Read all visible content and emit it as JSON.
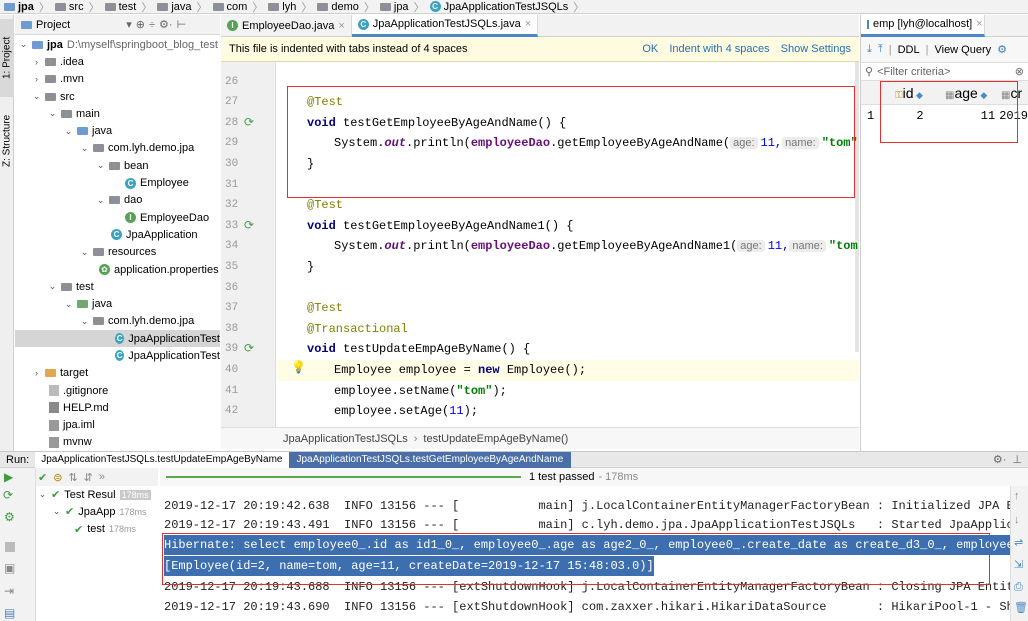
{
  "breadcrumb": [
    "jpa",
    "src",
    "test",
    "java",
    "com",
    "lyh",
    "demo",
    "jpa",
    "JpaApplicationTestJSQLs"
  ],
  "side_tabs": {
    "project": "1: Project",
    "structure": "Z: Structure"
  },
  "project_panel": {
    "title": "Project",
    "tree": [
      {
        "label": "jpa",
        "extra": "D:\\myself\\springboot_blog_test",
        "bold": true
      },
      {
        "label": ".idea"
      },
      {
        "label": ".mvn"
      },
      {
        "label": "src"
      },
      {
        "label": "main"
      },
      {
        "label": "java"
      },
      {
        "label": "com.lyh.demo.jpa"
      },
      {
        "label": "bean"
      },
      {
        "label": "Employee"
      },
      {
        "label": "dao"
      },
      {
        "label": "EmployeeDao"
      },
      {
        "label": "JpaApplication"
      },
      {
        "label": "resources"
      },
      {
        "label": "application.properties"
      },
      {
        "label": "test"
      },
      {
        "label": "java"
      },
      {
        "label": "com.lyh.demo.jpa"
      },
      {
        "label": "JpaApplicationTest"
      },
      {
        "label": "JpaApplicationTest"
      },
      {
        "label": "target"
      },
      {
        "label": ".gitignore"
      },
      {
        "label": "HELP.md"
      },
      {
        "label": "jpa.iml"
      },
      {
        "label": "mvnw"
      }
    ]
  },
  "editor": {
    "tabs": [
      {
        "label": "EmployeeDao.java",
        "active": false
      },
      {
        "label": "JpaApplicationTestJSQLs.java",
        "active": true
      }
    ],
    "notice": "This file is indented with tabs instead of 4 spaces",
    "notice_actions": [
      "OK",
      "Indent with 4 spaces",
      "Show Settings"
    ],
    "line_numbers": [
      "26",
      "27",
      "28",
      "29",
      "30",
      "31",
      "32",
      "33",
      "34",
      "35",
      "36",
      "37",
      "38",
      "39",
      "40",
      "41",
      "42"
    ],
    "code": {
      "l27": "@Test",
      "l28_kw": "void",
      "l28": " testGetEmployeeByAgeAndName() {",
      "l29_pre": "System.",
      "l29_out": "out",
      "l29_mid": ".println(",
      "l29_dao": "employeeDao",
      "l29_call": ".getEmployeeByAgeAndName(",
      "l29_h1": "age:",
      "l29_v1": "11,",
      "l29_h2": "name:",
      "l29_v2": "\"tom\"",
      "l30": "}",
      "l32": "@Test",
      "l33_kw": "void",
      "l33": " testGetEmployeeByAgeAndName1() {",
      "l34_call": ".getEmployeeByAgeAndName1(",
      "l35": "}",
      "l37": "@Test",
      "l38": "@Transactional",
      "l39_kw": "void",
      "l39": " testUpdateEmpAgeByName() {",
      "l40_a": "Employee employee = ",
      "l40_new": "new",
      "l40_b": " Employee();",
      "l41_a": "employee.setName(",
      "l41_s": "\"tom\"",
      "l41_b": ");",
      "l42_a": "employee.setAge(",
      "l42_n": "11",
      "l42_b": ");"
    },
    "crumb": [
      "JpaApplicationTestJSQLs",
      "testUpdateEmpAgeByName()"
    ]
  },
  "db_panel": {
    "tab": "emp [lyh@localhost]",
    "toolbar": [
      "DDL",
      "View Query"
    ],
    "filter_placeholder": "<Filter criteria>",
    "columns": [
      "id",
      "age",
      "cr"
    ],
    "rows": [
      {
        "num": "1",
        "id": "2",
        "age": "11",
        "cr": "2019"
      }
    ]
  },
  "run_panel": {
    "label": "Run:",
    "tabs": [
      "JpaApplicationTestJSQLs.testUpdateEmpAgeByName",
      "JpaApplicationTestJSQLs.testGetEmployeeByAgeAndName"
    ],
    "status": "1 test passed",
    "duration": "- 178ms",
    "tree": [
      {
        "label": "Test Resul",
        "time": "178ms"
      },
      {
        "label": "JpaApp",
        "time": "178ms"
      },
      {
        "label": "test",
        "time": "178ms"
      }
    ],
    "console": [
      "2019-12-17 20:19:42.638  INFO 13156 --- [           main] j.LocalContainerEntityManagerFactoryBean : Initialized JPA EntityManag",
      "2019-12-17 20:19:43.491  INFO 13156 --- [           main] c.lyh.demo.jpa.JpaApplicationTestJSQLs   : Started JpaApplicationTestJ",
      "Hibernate: select employee0_.id as id1_0_, employee0_.age as age2_0_, employee0_.create_date as create_d3_0_, employee0_.name as",
      "[Employee(id=2, name=tom, age=11, createDate=2019-12-17 15:48:03.0)]",
      "2019-12-17 20:19:43.688  INFO 13156 --- [extShutdownHook] j.LocalContainerEntityManagerFactoryBean : Closing JPA EntityManagerFa",
      "2019-12-17 20:19:43.690  INFO 13156 --- [extShutdownHook] com.zaxxer.hikari.HikariDataSource       : HikariPool-1 - Shutdown ini"
    ]
  }
}
